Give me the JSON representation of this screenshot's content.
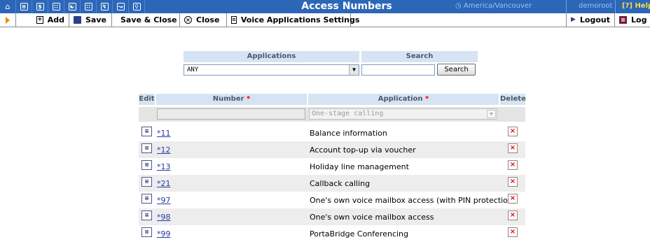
{
  "header": {
    "title": "Access Numbers",
    "timezone": "America/Vancouver",
    "user": "demoroot",
    "help": "Help",
    "nav_icons": [
      "home-icon",
      "list-icon",
      "dollar-icon",
      "grid-icon",
      "person-icon",
      "customers-icon",
      "phone-icon",
      "chart-icon",
      "search-icon"
    ]
  },
  "toolbar": {
    "add": "Add",
    "save": "Save",
    "save_close": "Save & Close",
    "close": "Close",
    "voice_settings": "Voice Applications Settings",
    "logout": "Logout",
    "log": "Log"
  },
  "filter": {
    "applications_label": "Applications",
    "applications_value": "ANY",
    "search_label": "Search",
    "search_value": "",
    "search_button": "Search"
  },
  "table": {
    "headers": {
      "edit": "Edit",
      "number": "Number",
      "application": "Application",
      "delete": "Delete",
      "required_mark": "*"
    },
    "new_row": {
      "number": "",
      "application": "One-stage calling"
    },
    "rows": [
      {
        "number": "*11",
        "application": "Balance information"
      },
      {
        "number": "*12",
        "application": "Account top-up via voucher"
      },
      {
        "number": "*13",
        "application": "Holiday line management"
      },
      {
        "number": "*21",
        "application": "Callback calling"
      },
      {
        "number": "*97",
        "application": "One's own voice mailbox access (with PIN protection)"
      },
      {
        "number": "*98",
        "application": "One's own voice mailbox access"
      },
      {
        "number": "*99",
        "application": "PortaBridge Conferencing"
      }
    ]
  },
  "colors": {
    "header_bg": "#2c67b7",
    "accent_orange": "#f08a00",
    "table_header": "#d6e3f2",
    "delete_red": "#e00000"
  }
}
